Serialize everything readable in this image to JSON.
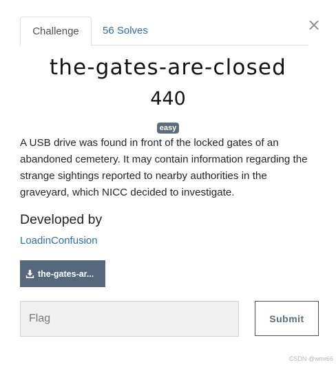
{
  "tabs": {
    "challenge_label": "Challenge",
    "solves_label": "56 Solves"
  },
  "close_symbol": "×",
  "challenge": {
    "name": "the-gates-are-closed",
    "points": "440",
    "difficulty": "easy",
    "description": "A USB drive was found in front of the locked gates of an abandoned cemetery. It may contain information regarding the strange sightings reported to nearby authorities in the graveyard, which NICC decided to investigate."
  },
  "author": {
    "heading": "Developed by",
    "name": "LoadinConfusion"
  },
  "file": {
    "label": "the-gates-ar...",
    "icon": "download-icon"
  },
  "flag_form": {
    "placeholder": "Flag",
    "value": "",
    "submit_label": "Submit"
  },
  "watermark": "CSDN @wmr66",
  "colors": {
    "link": "#2a6fad",
    "badge": "#5b6c7d",
    "file_button": "#55687d"
  }
}
